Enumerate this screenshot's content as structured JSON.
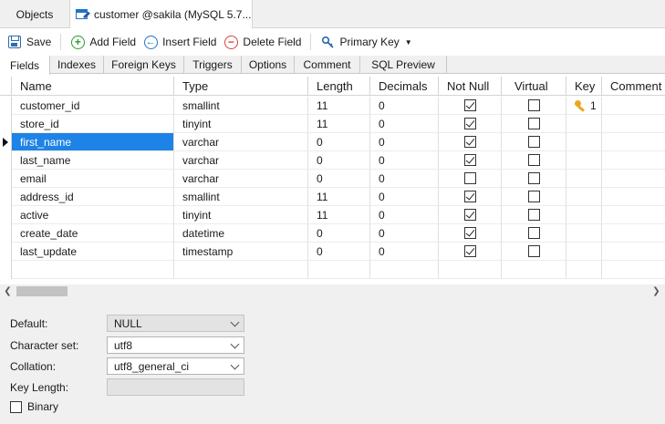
{
  "doc_tabs": {
    "objects": "Objects",
    "customer": "customer @sakila (MySQL 5.7..."
  },
  "toolbar": {
    "save": "Save",
    "add_field": "Add Field",
    "insert_field": "Insert Field",
    "delete_field": "Delete Field",
    "primary_key": "Primary Key"
  },
  "sub_tabs": [
    "Fields",
    "Indexes",
    "Foreign Keys",
    "Triggers",
    "Options",
    "Comment",
    "SQL Preview"
  ],
  "columns": {
    "name": "Name",
    "type": "Type",
    "length": "Length",
    "decimals": "Decimals",
    "not_null": "Not Null",
    "virtual": "Virtual",
    "key": "Key",
    "comment": "Comment"
  },
  "rows": [
    {
      "name": "customer_id",
      "type": "smallint",
      "length": "11",
      "decimals": "0",
      "not_null": true,
      "virtual": false,
      "key": "1"
    },
    {
      "name": "store_id",
      "type": "tinyint",
      "length": "11",
      "decimals": "0",
      "not_null": true,
      "virtual": false,
      "key": ""
    },
    {
      "name": "first_name",
      "type": "varchar",
      "length": "0",
      "decimals": "0",
      "not_null": true,
      "virtual": false,
      "key": ""
    },
    {
      "name": "last_name",
      "type": "varchar",
      "length": "0",
      "decimals": "0",
      "not_null": true,
      "virtual": false,
      "key": ""
    },
    {
      "name": "email",
      "type": "varchar",
      "length": "0",
      "decimals": "0",
      "not_null": false,
      "virtual": false,
      "key": ""
    },
    {
      "name": "address_id",
      "type": "smallint",
      "length": "11",
      "decimals": "0",
      "not_null": true,
      "virtual": false,
      "key": ""
    },
    {
      "name": "active",
      "type": "tinyint",
      "length": "11",
      "decimals": "0",
      "not_null": true,
      "virtual": false,
      "key": ""
    },
    {
      "name": "create_date",
      "type": "datetime",
      "length": "0",
      "decimals": "0",
      "not_null": true,
      "virtual": false,
      "key": ""
    },
    {
      "name": "last_update",
      "type": "timestamp",
      "length": "0",
      "decimals": "0",
      "not_null": true,
      "virtual": false,
      "key": ""
    }
  ],
  "selected_row": 2,
  "props": {
    "default_label": "Default:",
    "default_value": "NULL",
    "charset_label": "Character set:",
    "charset_value": "utf8",
    "collation_label": "Collation:",
    "collation_value": "utf8_general_ci",
    "key_length_label": "Key Length:",
    "key_length_value": "",
    "binary_label": "Binary"
  },
  "colors": {
    "selection": "#1e83e6",
    "key_icon": "#e8a81e"
  },
  "icons": {
    "save": "save-icon",
    "add": "plus-circle-icon",
    "insert": "arrow-left-circle-icon",
    "delete": "minus-circle-icon",
    "primary_key": "key-icon"
  }
}
